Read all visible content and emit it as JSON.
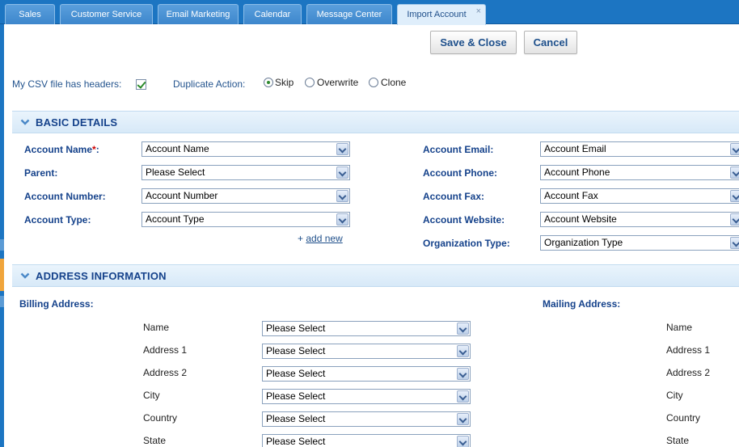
{
  "tabs": [
    {
      "label": "Sales"
    },
    {
      "label": "Customer Service"
    },
    {
      "label": "Email Marketing"
    },
    {
      "label": "Calendar"
    },
    {
      "label": "Message Center"
    },
    {
      "label": "Import Account",
      "close": "×"
    }
  ],
  "toolbar": {
    "save_close_label": "Save & Close",
    "cancel_label": "Cancel"
  },
  "options": {
    "csv_headers_label": "My CSV file has headers:",
    "duplicate_action_label": "Duplicate Action:",
    "radios": [
      {
        "label": "Skip"
      },
      {
        "label": "Overwrite"
      },
      {
        "label": "Clone"
      }
    ]
  },
  "basic_details": {
    "title": "BASIC DETAILS",
    "left_fields": [
      {
        "label": "Account Name",
        "required_mark": "*",
        "suffix": ":",
        "value": "Account Name"
      },
      {
        "label": "Parent:",
        "value": "Please Select"
      },
      {
        "label": "Account Number:",
        "value": "Account Number"
      },
      {
        "label": "Account Type:",
        "value": "Account Type"
      }
    ],
    "right_fields": [
      {
        "label": "Account Email:",
        "value": "Account Email"
      },
      {
        "label": "Account Phone:",
        "value": "Account Phone"
      },
      {
        "label": "Account Fax:",
        "value": "Account Fax"
      },
      {
        "label": "Account Website:",
        "value": "Account Website"
      },
      {
        "label": "Organization Type:",
        "value": "Organization Type"
      }
    ],
    "add_new_plus": "+",
    "add_new_label": "add new"
  },
  "address_information": {
    "title": "ADDRESS INFORMATION",
    "billing_label": "Billing Address:",
    "mailing_label": "Mailing Address:",
    "billing_fields": [
      {
        "label": "Name",
        "value": "Please Select"
      },
      {
        "label": "Address 1",
        "value": "Please Select"
      },
      {
        "label": "Address 2",
        "value": "Please Select"
      },
      {
        "label": "City",
        "value": "Please Select"
      },
      {
        "label": "Country",
        "value": "Please Select"
      },
      {
        "label": "State",
        "value": "Please Select"
      }
    ],
    "mailing_fields": [
      {
        "label": "Name"
      },
      {
        "label": "Address 1"
      },
      {
        "label": "Address 2"
      },
      {
        "label": "City"
      },
      {
        "label": "Country"
      },
      {
        "label": "State"
      }
    ]
  }
}
